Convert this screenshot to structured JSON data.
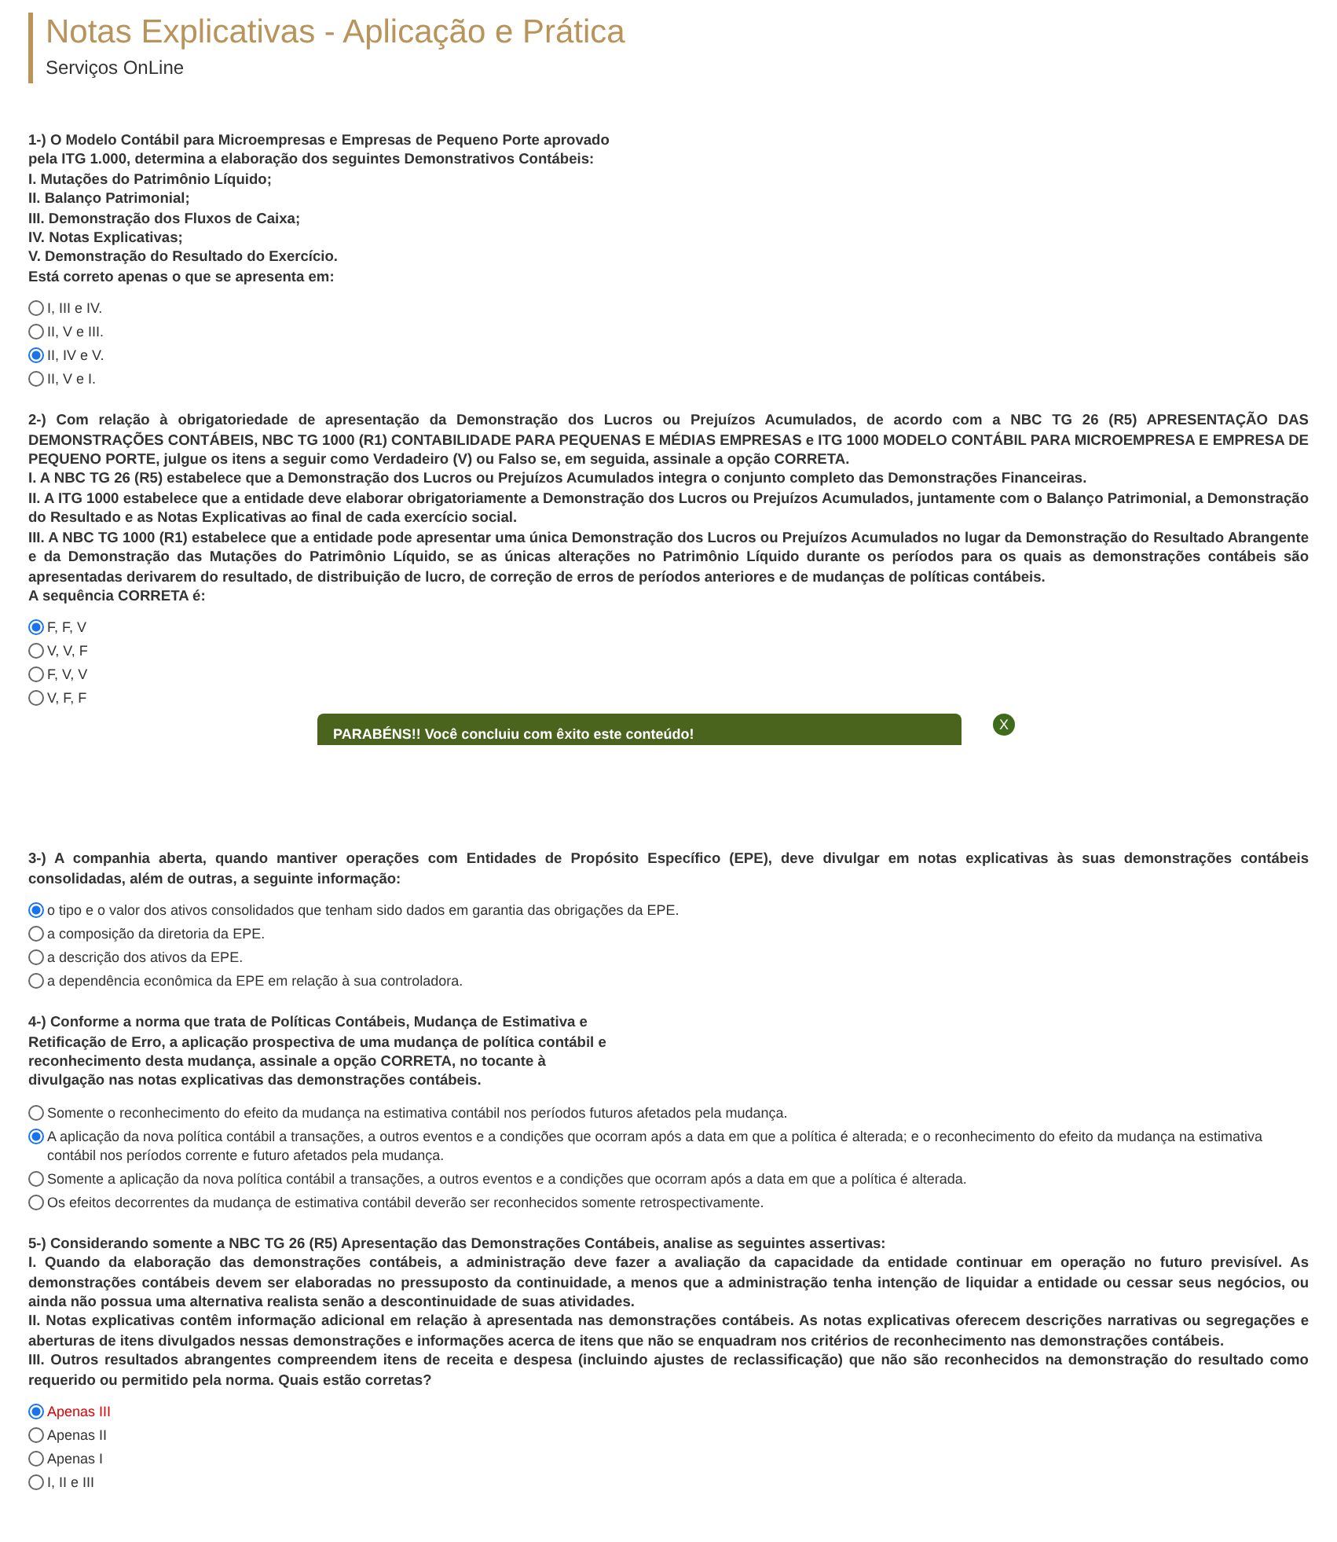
{
  "header": {
    "title": "Notas Explicativas - Aplicação e Prática",
    "subtitle": "Serviços OnLine"
  },
  "questions": [
    {
      "kind": "narrow",
      "paragraphs": [
        "1-) O Modelo Contábil para Microempresas e Empresas de Pequeno Porte aprovado pela ITG 1.000, determina a elaboração dos seguintes Demonstrativos Contábeis:",
        "I. Mutações do Patrimônio Líquido;",
        "II. Balanço Patrimonial;",
        "III. Demonstração dos Fluxos de Caixa;",
        "IV. Notas Explicativas;",
        "V. Demonstração do Resultado do Exercício.",
        "Está correto apenas o que se apresenta em:"
      ],
      "options": [
        {
          "label": "I, III e IV.",
          "selected": false,
          "flagged": false
        },
        {
          "label": "II, V e III.",
          "selected": false,
          "flagged": false
        },
        {
          "label": "II, IV e V.",
          "selected": true,
          "flagged": false
        },
        {
          "label": "II, V e I.",
          "selected": false,
          "flagged": false
        }
      ]
    },
    {
      "kind": "wide",
      "paragraphs": [
        "2-) Com relação à obrigatoriedade de apresentação da Demonstração dos Lucros ou Prejuízos Acumulados, de acordo com a NBC TG 26 (R5) APRESENTAÇÃO DAS DEMONSTRAÇÕES CONTÁBEIS, NBC TG 1000 (R1) CONTABILIDADE PARA PEQUENAS E MÉDIAS EMPRESAS e ITG 1000 MODELO CONTÁBIL PARA MICROEMPRESA E EMPRESA DE PEQUENO PORTE, julgue os itens a seguir como Verdadeiro (V) ou Falso se, em seguida, assinale a opção CORRETA.",
        "I. A NBC TG 26 (R5) estabelece que a Demonstração dos Lucros ou Prejuízos Acumulados integra o conjunto completo das Demonstrações Financeiras.",
        "II. A ITG 1000 estabelece que a entidade deve elaborar obrigatoriamente a Demonstração dos Lucros ou Prejuízos Acumulados, juntamente com o Balanço Patrimonial, a Demonstração do Resultado e as Notas Explicativas ao final de cada exercício social.",
        "III. A NBC TG 1000 (R1) estabelece que a entidade pode apresentar uma única Demonstração dos Lucros ou Prejuízos Acumulados no lugar da Demonstração do Resultado Abrangente e da Demonstração das Mutações do Patrimônio Líquido, se as únicas alterações no Patrimônio Líquido durante os períodos para os quais as demonstrações contábeis são apresentadas derivarem do resultado, de distribuição de lucro, de correção de erros de períodos anteriores e de mudanças de políticas contábeis.",
        "A sequência CORRETA é:"
      ],
      "options": [
        {
          "label": "F, F, V",
          "selected": true,
          "flagged": false
        },
        {
          "label": "V, V, F",
          "selected": false,
          "flagged": false
        },
        {
          "label": "F, V, V",
          "selected": false,
          "flagged": false
        },
        {
          "label": "V, F, F",
          "selected": false,
          "flagged": false
        }
      ]
    },
    {
      "kind": "wide",
      "paragraphs": [
        "3-) A companhia aberta, quando mantiver operações com Entidades de Propósito Específico (EPE), deve divulgar em notas explicativas às suas demonstrações contábeis consolidadas, além de outras, a seguinte informação:"
      ],
      "options": [
        {
          "label": "o tipo e o valor dos ativos consolidados que tenham sido dados em garantia das obrigações da EPE.",
          "selected": true,
          "flagged": false
        },
        {
          "label": "a composição da diretoria da EPE.",
          "selected": false,
          "flagged": false
        },
        {
          "label": "a descrição dos ativos da EPE.",
          "selected": false,
          "flagged": false
        },
        {
          "label": "a dependência econômica da EPE em relação à sua controladora.",
          "selected": false,
          "flagged": false
        }
      ]
    },
    {
      "kind": "narrow",
      "paragraphs": [
        "4-) Conforme a norma que trata de Políticas Contábeis, Mudança de Estimativa e Retificação de Erro, a aplicação prospectiva de uma mudança de política contábil e reconhecimento desta mudança, assinale a opção CORRETA, no tocante à divulgação nas notas explicativas das demonstrações contábeis."
      ],
      "options": [
        {
          "label": "Somente o reconhecimento do efeito da mudança na estimativa contábil nos períodos futuros afetados pela mudança.",
          "selected": false,
          "flagged": false
        },
        {
          "label": "A aplicação da nova política contábil a transações, a outros eventos e a condições que ocorram após a data em que a política é alterada; e o reconhecimento do efeito da mudança na estimativa contábil nos períodos corrente e futuro afetados pela mudança.",
          "selected": true,
          "flagged": false
        },
        {
          "label": "Somente a aplicação da nova política contábil a transações, a outros eventos e a condições que ocorram após a data em que a política é alterada.",
          "selected": false,
          "flagged": false
        },
        {
          "label": "Os efeitos decorrentes da mudança de estimativa contábil deverão ser reconhecidos somente retrospectivamente.",
          "selected": false,
          "flagged": false
        }
      ]
    },
    {
      "kind": "wide",
      "paragraphs": [
        "5-) Considerando somente a NBC TG 26 (R5) Apresentação das Demonstrações Contábeis, analise as seguintes assertivas:",
        "I. Quando da elaboração das demonstrações contábeis, a administração deve fazer a avaliação da capacidade da entidade continuar em operação no futuro previsível. As demonstrações contábeis devem ser elaboradas no pressuposto da continuidade, a menos que a administração tenha intenção de liquidar a entidade ou cessar seus negócios, ou ainda não possua uma alternativa realista senão a descontinuidade de suas atividades.",
        "II. Notas explicativas contêm informação adicional em relação à apresentada nas demonstrações contábeis. As notas explicativas oferecem descrições narrativas ou segregações e aberturas de itens divulgados nessas demonstrações e informações acerca de itens que não se enquadram nos critérios de reconhecimento nas demonstrações contábeis.",
        "III. Outros resultados abrangentes compreendem itens de receita e despesa (incluindo ajustes de reclassificação) que não são reconhecidos na demonstração do resultado como requerido ou permitido pela norma. Quais estão corretas?"
      ],
      "options": [
        {
          "label": "Apenas III",
          "selected": true,
          "flagged": true
        },
        {
          "label": "Apenas II",
          "selected": false,
          "flagged": false
        },
        {
          "label": "Apenas I",
          "selected": false,
          "flagged": false
        },
        {
          "label": "I, II e III",
          "selected": false,
          "flagged": false
        }
      ]
    }
  ],
  "banner": {
    "message": "PARABÉNS!! Você concluiu com êxito este conteúdo!",
    "close": "X"
  }
}
